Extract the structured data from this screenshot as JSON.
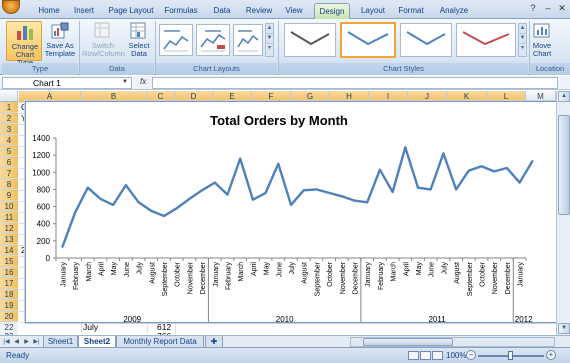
{
  "ribbon": {
    "tabs": [
      "Home",
      "Insert",
      "Page Layout",
      "Formulas",
      "Data",
      "Review",
      "View",
      "Design",
      "Layout",
      "Format",
      "Analyze"
    ],
    "active_tab": "Design",
    "groups": {
      "type": {
        "label": "Type",
        "change_chart_type": "Change Chart Type",
        "save_as_template": "Save As Template"
      },
      "data": {
        "label": "Data",
        "switch_row_column": "Switch Row/Column",
        "select_data": "Select Data"
      },
      "chart_layouts": {
        "label": "Chart Layouts"
      },
      "chart_styles": {
        "label": "Chart Styles",
        "thumb_colors": [
          "#5a5a5a",
          "#4f81bd",
          "#4f81bd",
          "#c0504d"
        ],
        "selected_index": 1
      },
      "location": {
        "label": "Location",
        "move_chart": "Move Chart"
      }
    }
  },
  "formula_bar": {
    "name_box": "Chart 1",
    "fx": "fx",
    "formula": ""
  },
  "grid": {
    "columns": [
      "A",
      "B",
      "C",
      "D",
      "E",
      "F",
      "G",
      "H",
      "I",
      "J",
      "K",
      "L",
      "M"
    ],
    "rows": [
      "1",
      "2",
      "3",
      "4",
      "5",
      "6",
      "7",
      "8",
      "9",
      "10",
      "11",
      "12",
      "13",
      "14",
      "15",
      "16",
      "17",
      "18",
      "19",
      "20",
      "21",
      "22",
      "23"
    ],
    "visible_cells": {
      "row1_a": "Ci",
      "row2_a": "Ye",
      "row20_a": "20",
      "row22_b": "July",
      "row22_c": "612",
      "row23_c": "766"
    }
  },
  "sheets": {
    "tabs": [
      "Sheet1",
      "Sheet2",
      "Monthly Report Data"
    ],
    "active": "Sheet2"
  },
  "status": {
    "text": "Ready",
    "zoom": "100%"
  },
  "chart_data": {
    "type": "line",
    "title": "Total Orders by Month",
    "xlabel": "",
    "ylabel": "",
    "ylim": [
      0,
      1400
    ],
    "yticks": [
      0,
      200,
      400,
      600,
      800,
      1000,
      1200,
      1400
    ],
    "grid": false,
    "legend": "none",
    "line_color": "#4f81bd",
    "months": [
      "January",
      "February",
      "March",
      "April",
      "May",
      "June",
      "July",
      "August",
      "September",
      "October",
      "November",
      "December",
      "January",
      "February",
      "March",
      "April",
      "May",
      "June",
      "July",
      "August",
      "September",
      "October",
      "November",
      "December",
      "January",
      "February",
      "March",
      "April",
      "May",
      "June",
      "July",
      "August",
      "September",
      "October",
      "November",
      "December",
      "January"
    ],
    "year_groups": [
      {
        "label": "2009",
        "count": 12
      },
      {
        "label": "2010",
        "count": 12
      },
      {
        "label": "2011",
        "count": 12
      },
      {
        "label": "2012",
        "count": 1
      }
    ],
    "series": [
      {
        "values": [
          130,
          530,
          820,
          690,
          620,
          850,
          650,
          550,
          490,
          580,
          690,
          790,
          880,
          740,
          1160,
          680,
          760,
          1100,
          620,
          790,
          800,
          760,
          720,
          670,
          650,
          1030,
          770,
          1290,
          820,
          800,
          1220,
          800,
          1020,
          1070,
          1010,
          1050,
          880,
          1130
        ]
      }
    ]
  }
}
